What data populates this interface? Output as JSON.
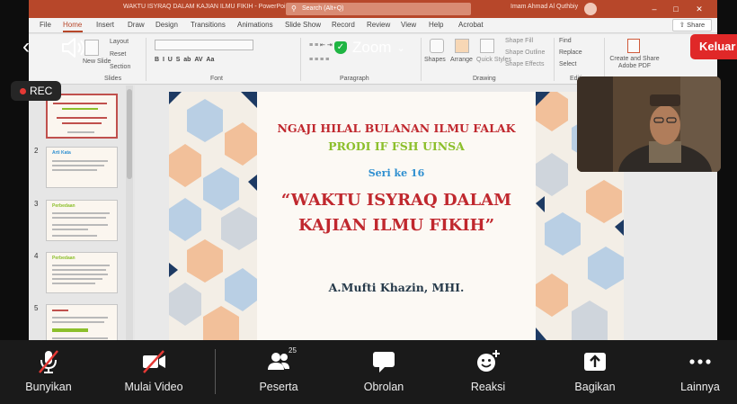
{
  "powerpoint": {
    "window_title": "WAKTU ISYRAQ DALAM KAJIAN ILMU FIKIH  -  PowerPoint",
    "search_placeholder": "Search (Alt+Q)",
    "user_name": "Imam Ahmad Al Quthbiy",
    "menu_tabs": [
      "File",
      "Home",
      "Insert",
      "Draw",
      "Design",
      "Transitions",
      "Animations",
      "Slide Show",
      "Record",
      "Review",
      "View",
      "Help",
      "Acrobat"
    ],
    "share_label": "Share",
    "ribbon": {
      "slides_group": "Slides",
      "font_group": "Font",
      "paragraph_group": "Paragraph",
      "drawing_group": "Drawing",
      "editing_group": "Editing",
      "new_slide": "New Slide",
      "layout": "Layout",
      "reset": "Reset",
      "section": "Section",
      "shapes": "Shapes",
      "arrange": "Arrange",
      "quick_styles": "Quick Styles",
      "shape_fill": "Shape Fill",
      "shape_outline": "Shape Outline",
      "shape_effects": "Shape Effects",
      "find": "Find",
      "replace": "Replace",
      "select": "Select",
      "create_share_pdf": "Create and Share Adobe PDF"
    },
    "thumbnails": [
      {
        "num": "1"
      },
      {
        "num": "2",
        "title": "Arti Kata"
      },
      {
        "num": "3",
        "title": "Perbedaan"
      },
      {
        "num": "4",
        "title": "Perbedaan"
      },
      {
        "num": "5",
        "title": ""
      }
    ],
    "slide": {
      "line1": "NGAJI HILAL BULANAN ILMU FALAK",
      "line2": "PRODI IF FSH UINSA",
      "line3": "Seri ke 16",
      "line4": "“WAKTU ISYRAQ DALAM",
      "line5": "KAJIAN ILMU FIKIH”",
      "line6": "A.Mufti Khazin, MHI."
    }
  },
  "zoom": {
    "app_name": "Zoom",
    "leave_label": "Keluar",
    "rec_label": "REC",
    "toolbar": {
      "unmute": "Bunyikan",
      "start_video": "Mulai Video",
      "participants": "Peserta",
      "participants_count": "25",
      "chat": "Obrolan",
      "reactions": "Reaksi",
      "share": "Bagikan",
      "more": "Lainnya"
    },
    "colors": {
      "leave": "#e02828",
      "secure": "#1fb543",
      "ppt_accent": "#b7472a"
    }
  }
}
